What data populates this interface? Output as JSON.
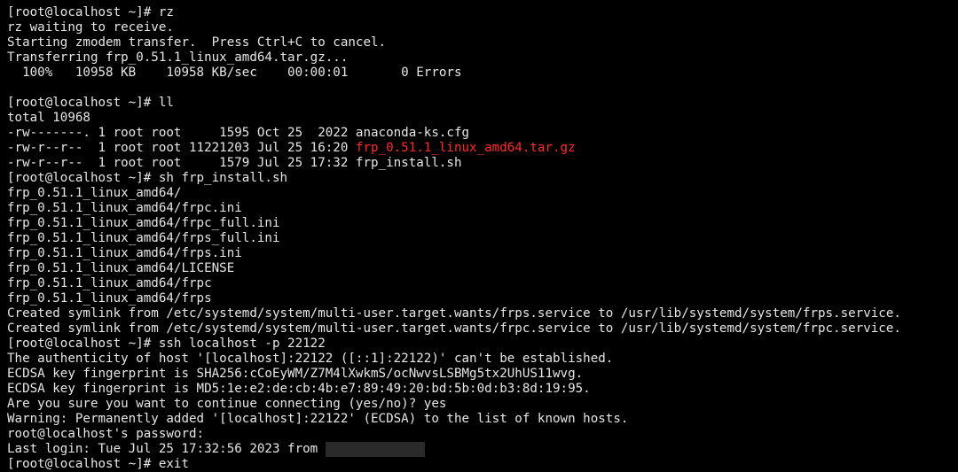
{
  "colors": {
    "background": "#000000",
    "text": "#e6e6e6",
    "highlight": "#ff2a2a"
  },
  "terminal": {
    "lines": [
      {
        "segments": [
          {
            "text": "[root@localhost ~]# rz"
          }
        ]
      },
      {
        "segments": [
          {
            "text": "rz waiting to receive."
          }
        ]
      },
      {
        "segments": [
          {
            "text": "Starting zmodem transfer.  Press Ctrl+C to cancel."
          }
        ]
      },
      {
        "segments": [
          {
            "text": "Transferring frp_0.51.1_linux_amd64.tar.gz..."
          }
        ]
      },
      {
        "segments": [
          {
            "text": "  100%   10958 KB    10958 KB/sec    00:00:01       0 Errors"
          }
        ]
      },
      {
        "segments": [
          {
            "text": ""
          }
        ]
      },
      {
        "segments": [
          {
            "text": "[root@localhost ~]# ll"
          }
        ]
      },
      {
        "segments": [
          {
            "text": "total 10968"
          }
        ]
      },
      {
        "segments": [
          {
            "text": "-rw-------. 1 root root     1595 Oct 25  2022 anaconda-ks.cfg"
          }
        ]
      },
      {
        "segments": [
          {
            "text": "-rw-r--r--  1 root root 11221203 Jul 25 16:20 "
          },
          {
            "text": "frp_0.51.1_linux_amd64.tar.gz",
            "red": true
          }
        ]
      },
      {
        "segments": [
          {
            "text": "-rw-r--r--  1 root root     1579 Jul 25 17:32 frp_install.sh"
          }
        ]
      },
      {
        "segments": [
          {
            "text": "[root@localhost ~]# sh frp_install.sh"
          }
        ]
      },
      {
        "segments": [
          {
            "text": "frp_0.51.1_linux_amd64/"
          }
        ]
      },
      {
        "segments": [
          {
            "text": "frp_0.51.1_linux_amd64/frpc.ini"
          }
        ]
      },
      {
        "segments": [
          {
            "text": "frp_0.51.1_linux_amd64/frpc_full.ini"
          }
        ]
      },
      {
        "segments": [
          {
            "text": "frp_0.51.1_linux_amd64/frps_full.ini"
          }
        ]
      },
      {
        "segments": [
          {
            "text": "frp_0.51.1_linux_amd64/frps.ini"
          }
        ]
      },
      {
        "segments": [
          {
            "text": "frp_0.51.1_linux_amd64/LICENSE"
          }
        ]
      },
      {
        "segments": [
          {
            "text": "frp_0.51.1_linux_amd64/frpc"
          }
        ]
      },
      {
        "segments": [
          {
            "text": "frp_0.51.1_linux_amd64/frps"
          }
        ]
      },
      {
        "segments": [
          {
            "text": "Created symlink from /etc/systemd/system/multi-user.target.wants/frps.service to /usr/lib/systemd/system/frps.service."
          }
        ]
      },
      {
        "segments": [
          {
            "text": "Created symlink from /etc/systemd/system/multi-user.target.wants/frpc.service to /usr/lib/systemd/system/frpc.service."
          }
        ]
      },
      {
        "segments": [
          {
            "text": "[root@localhost ~]# ssh localhost -p 22122"
          }
        ]
      },
      {
        "segments": [
          {
            "text": "The authenticity of host '[localhost]:22122 ([::1]:22122)' can't be established."
          }
        ]
      },
      {
        "segments": [
          {
            "text": "ECDSA key fingerprint is SHA256:cCoEyWM/Z7M4lXwkmS/ocNwvsLSBMg5tx2UhUS11wvg."
          }
        ]
      },
      {
        "segments": [
          {
            "text": "ECDSA key fingerprint is MD5:1e:e2:de:cb:4b:e7:89:49:20:bd:5b:0d:b3:8d:19:95."
          }
        ]
      },
      {
        "segments": [
          {
            "text": "Are you sure you want to continue connecting (yes/no)? yes"
          }
        ]
      },
      {
        "segments": [
          {
            "text": "Warning: Permanently added '[localhost]:22122' (ECDSA) to the list of known hosts."
          }
        ]
      },
      {
        "segments": [
          {
            "text": "root@localhost's password:"
          }
        ]
      },
      {
        "segments": [
          {
            "text": "Last login: Tue Jul 25 17:32:56 2023 from "
          },
          {
            "redacted": true
          }
        ]
      },
      {
        "segments": [
          {
            "text": "[root@localhost ~]# exit"
          }
        ]
      }
    ]
  }
}
